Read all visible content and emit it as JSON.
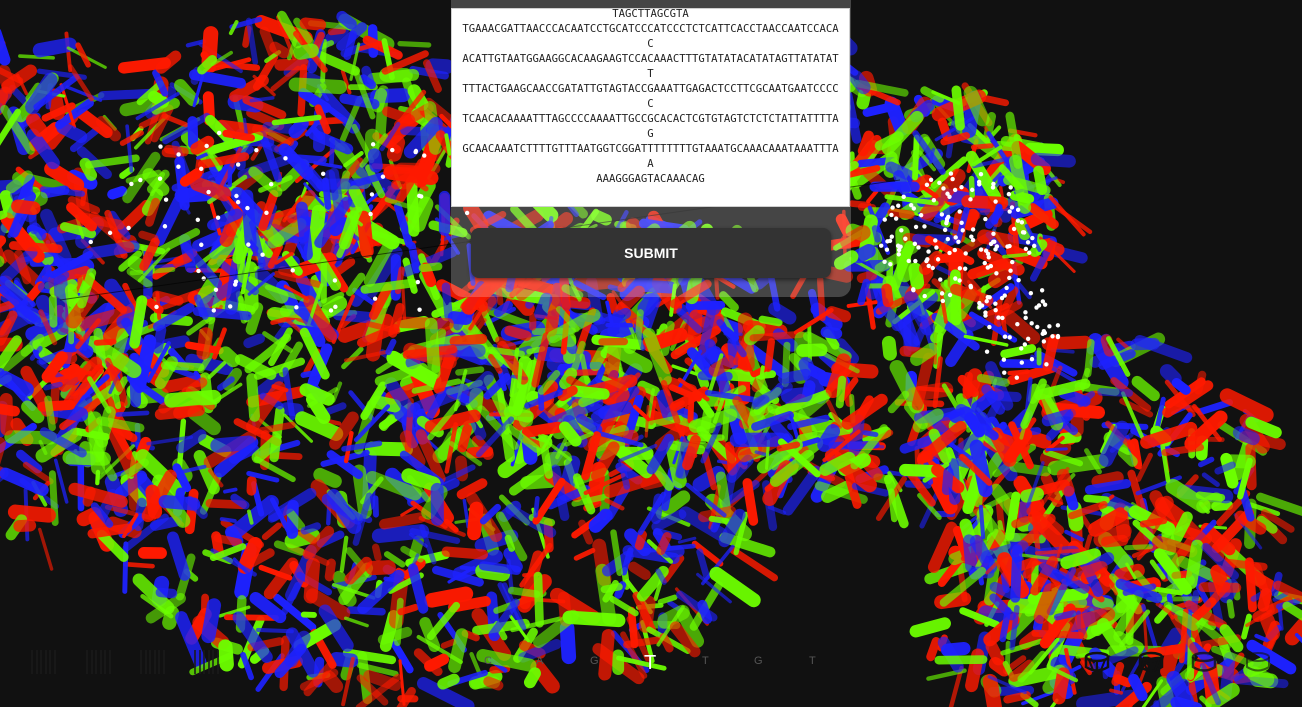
{
  "sequence": {
    "text": "TAGCTTAGCGTA\nTGAAACGATTAACCCACAATCCTGCATCCCATCCCTCTCATTCACCTAACCAATCCACAC\nACATTGTAATGGAAGGCACAAGAAGTCCACAAACTTTGTATATACATATAGTTATATATT\nTTTACTGAAGCAACCGATATTGTAGTACCGAAATTGAGACTCCTTCGCAATGAATCCCCC\nTCAACACAAAATTTAGCCCCAAAATTGCCGCACACTCGTGTAGTCTCTCTATTATTTTAG\nGCAACAAATCTTTTGTTTAATGGTCGGATTTTTTTTGTAAATGCAAACAAATAAATTTAA\nAAAGGGAGTACAAACAG"
  },
  "submit_label": "SUBMIT",
  "bases": [
    {
      "label": "C",
      "active": false
    },
    {
      "label": "A",
      "active": false
    },
    {
      "label": "G",
      "active": false
    },
    {
      "label": "T",
      "active": true
    },
    {
      "label": "T",
      "active": false
    },
    {
      "label": "G",
      "active": false
    },
    {
      "label": "T",
      "active": false
    }
  ],
  "instrument_icons": {
    "left": [
      "piano-keys-icon",
      "piano-keys-icon",
      "piano-keys-icon",
      "piano-keys-icon"
    ],
    "right": [
      "drum-icon",
      "drum-icon",
      "drum-icon",
      "drum-icon"
    ]
  },
  "colors": {
    "background": "#111111",
    "red": "#ff1a00",
    "green": "#6cff00",
    "blue": "#1e22ff",
    "button": "#333333"
  }
}
